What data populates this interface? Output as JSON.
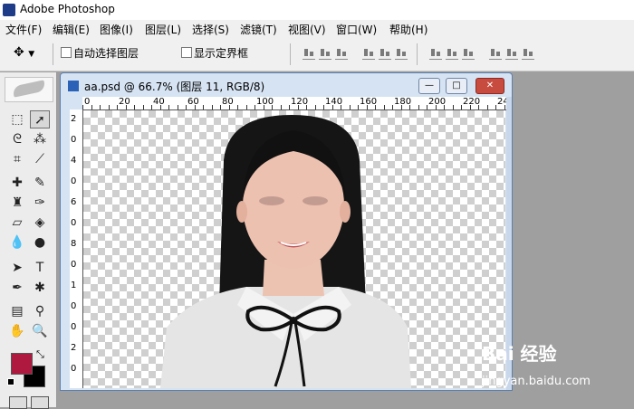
{
  "app": {
    "title": "Adobe Photoshop"
  },
  "menubar": {
    "items": [
      "文件(F)",
      "编辑(E)",
      "图像(I)",
      "图层(L)",
      "选择(S)",
      "滤镜(T)",
      "视图(V)",
      "窗口(W)",
      "帮助(H)"
    ]
  },
  "options_bar": {
    "tool_preset_icon": "move-tool-icon",
    "auto_select_label": "自动选择图层",
    "show_bounds_label": "显示定界框"
  },
  "colors": {
    "foreground": "#b0193f",
    "background": "#000000"
  },
  "document": {
    "title": "aa.psd @ 66.7% (图层 11, RGB/8)",
    "buttons": {
      "minimize": "—",
      "maximize": "□",
      "close": "✕"
    },
    "ruler_top": [
      "0",
      "20",
      "40",
      "60",
      "80",
      "100",
      "120",
      "140",
      "160",
      "180",
      "200",
      "220",
      "24"
    ],
    "ruler_left": [
      "2",
      "0",
      "4",
      "0",
      "6",
      "0",
      "8",
      "0",
      "1",
      "0",
      "0",
      "2",
      "0"
    ]
  },
  "watermark": {
    "brand": "Bai 经验",
    "url": "jingyan.baidu.com"
  }
}
